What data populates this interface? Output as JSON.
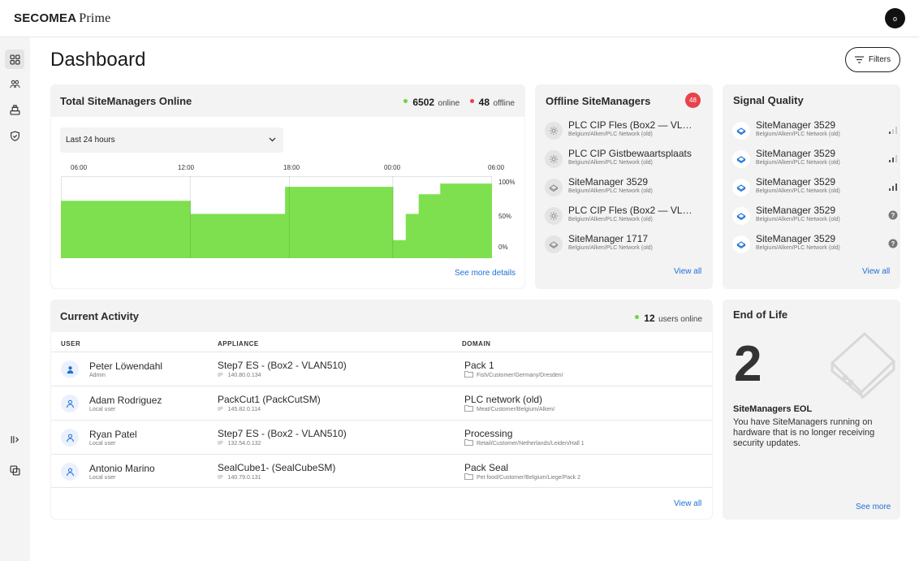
{
  "app": {
    "brand": "SECOMEA",
    "product": "Prime",
    "avatar_initial": "o"
  },
  "sidebar": {
    "items": [
      {
        "name": "dashboard",
        "active": true
      },
      {
        "name": "users"
      },
      {
        "name": "devices"
      },
      {
        "name": "security"
      },
      {
        "name": "collapse"
      },
      {
        "name": "switch-view"
      }
    ]
  },
  "page": {
    "title": "Dashboard",
    "filters_label": "Filters"
  },
  "total": {
    "title": "Total SiteManagers Online",
    "online_count": "6502",
    "online_label": "online",
    "offline_count": "48",
    "offline_label": "offline",
    "range": "Last 24 hours",
    "x_ticks": [
      "06:00",
      "12:00",
      "18:00",
      "00:00",
      "06:00"
    ],
    "y_ticks": [
      "100%",
      "50%",
      "0%"
    ],
    "link": "See more details",
    "colors": {
      "online": "#6bd640",
      "offline": "#e8424d",
      "bar": "#7ee04f"
    }
  },
  "chart_data": {
    "type": "area",
    "title": "Total SiteManagers Online",
    "x_ticks": [
      "06:00",
      "12:00",
      "18:00",
      "00:00",
      "06:00"
    ],
    "y_ticks": [
      "100%",
      "50%",
      "0%"
    ],
    "ylim": [
      0,
      100
    ],
    "grid": true,
    "segments": [
      {
        "from": 0.0,
        "to": 0.3,
        "value": 70
      },
      {
        "from": 0.3,
        "to": 0.52,
        "value": 54
      },
      {
        "from": 0.52,
        "to": 0.77,
        "value": 87
      },
      {
        "from": 0.77,
        "to": 0.8,
        "value": 22
      },
      {
        "from": 0.8,
        "to": 0.83,
        "value": 54
      },
      {
        "from": 0.83,
        "to": 0.88,
        "value": 78
      },
      {
        "from": 0.88,
        "to": 1.0,
        "value": 91
      }
    ]
  },
  "offline": {
    "title": "Offline SiteManagers",
    "badge": "48",
    "items": [
      {
        "name": "PLC CIP Fles (Box2 — VLAN...",
        "path": "Belgium/Alken/PLC Network (old)",
        "icon": "gear-icon"
      },
      {
        "name": "PLC CIP Gistbewaartsplaats",
        "path": "Belgium/Alken/PLC Network (old)",
        "icon": "gear-icon"
      },
      {
        "name": "SiteManager 3529",
        "path": "Belgium/Alken/PLC Network (old)",
        "icon": "sitemanager-icon"
      },
      {
        "name": "PLC CIP Fles (Box2 — VLAN...",
        "path": "Belgium/Alken/PLC Network (old)",
        "icon": "gear-icon"
      },
      {
        "name": "SiteManager 1717",
        "path": "Belgium/Alken/PLC Network (old)",
        "icon": "sitemanager-icon"
      }
    ],
    "view_all": "View all"
  },
  "signal": {
    "title": "Signal Quality",
    "items": [
      {
        "name": "SiteManager 3529",
        "path": "Belgium/Alken/PLC Network (old)",
        "signal": 1
      },
      {
        "name": "SiteManager 3529",
        "path": "Belgium/Alken/PLC Network (old)",
        "signal": 2
      },
      {
        "name": "SiteManager 3529",
        "path": "Belgium/Alken/PLC Network (old)",
        "signal": 3
      },
      {
        "name": "SiteManager 3529",
        "path": "Belgium/Alken/PLC Network (old)",
        "signal": 0
      },
      {
        "name": "SiteManager 3529",
        "path": "Belgium/Alken/PLC Network (old)",
        "signal": 0
      }
    ],
    "view_all": "View all"
  },
  "activity": {
    "title": "Current Activity",
    "users_count": "12",
    "users_label": "users online",
    "headers": {
      "user": "USER",
      "appliance": "APPLIANCE",
      "domain": "DOMAIN"
    },
    "ip_label": "IP",
    "rows": [
      {
        "user": "Peter Löwendahl",
        "role": "Admin",
        "appliance": "Step7 ES - (Box2 - VLAN510)",
        "ip": "140.80.0.134",
        "domain": "Pack 1",
        "domain_path": "Fish/Customer/Germany/Dresden/"
      },
      {
        "user": "Adam Rodriguez",
        "role": "Local user",
        "appliance": "PackCut1 (PackCutSM)",
        "ip": "145.82.0.114",
        "domain": "PLC network (old)",
        "domain_path": "Meat/Customer/Belgium/Alken/"
      },
      {
        "user": "Ryan Patel",
        "role": "Local user",
        "appliance": "Step7 ES - (Box2 - VLAN510)",
        "ip": "132.54.0.132",
        "domain": "Processing",
        "domain_path": "Retail/Customer/Netherlands/Leiden/Hall 1"
      },
      {
        "user": "Antonio Marino",
        "role": "Local user",
        "appliance": "SealCube1- (SealCubeSM)",
        "ip": "140.79.0.131",
        "domain": "Pack Seal",
        "domain_path": "Pet food/Customer/Belgium/Liege/Pack 2"
      }
    ],
    "view_all": "View all"
  },
  "eol": {
    "title": "End of Life",
    "count": "2",
    "heading": "SiteManagers EOL",
    "text": "You have SiteManagers running on hardware that is no longer receiving security updates.",
    "link": "See more"
  }
}
